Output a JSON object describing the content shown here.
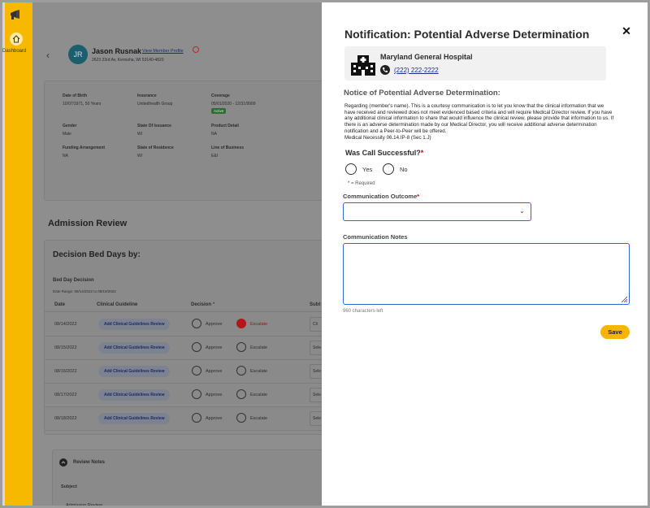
{
  "sidebar": {
    "nav_label": "Dashboard",
    "logo_icon": "bullhorn-icon",
    "home_icon": "home-icon",
    "accent_color": "#f7b800"
  },
  "member": {
    "initials": "JR",
    "name": "Jason Rusnak",
    "view_profile": "View Member Profile",
    "address": "2623 23rd Av, Kenosha, WI 53140-4820"
  },
  "info": {
    "dob_label": "Date of Birth",
    "dob": "10/07/1971, 50 Years",
    "insurance_label": "Insurance",
    "insurance": "Unitedhealth Group",
    "coverage_label": "Coverage",
    "coverage": "05/01/2020 - 12/31/9999",
    "coverage_status": "Active",
    "gender_label": "Gender",
    "gender": "Male",
    "state_ins_label": "State Of Issuance",
    "state_ins": "WI",
    "product_label": "Product Detail",
    "product": "NA",
    "funding_label": "Funding Arrangement",
    "funding": "NA",
    "residence_label": "State of Residence",
    "residence": "WI",
    "lob_label": "Line of Business",
    "lob": "E&I"
  },
  "admission": {
    "title": "Admission Review",
    "decision_title": "Decision Bed Days by:",
    "bed_day_title": "Bed Day Decision",
    "date_range": "Date Range: 08/14/2022 to 08/19/2022",
    "columns": [
      "Date",
      "Clinical Guideline",
      "Decision",
      "Subt"
    ],
    "guideline_btn": "Add Clinical Guidelines Review",
    "approve": "Approve",
    "escalate": "Escalate",
    "rows": [
      {
        "date": "08/14/2022",
        "select": "Cli"
      },
      {
        "date": "08/15/2022",
        "select": "Sele"
      },
      {
        "date": "08/16/2022",
        "select": "Sele"
      },
      {
        "date": "08/17/2022",
        "select": "Sele"
      },
      {
        "date": "08/18/2022",
        "select": "Sele"
      }
    ],
    "notes_title": "Review Notes",
    "notes_subject_label": "Subject",
    "notes_subject": "Admission Review"
  },
  "modal": {
    "title": "Notification: Potential Adverse Determination",
    "hospital_name": "Maryland General Hospital",
    "hospital_phone": "(222) 222-2222",
    "notice_title": "Notice of Potential Adverse Determination:",
    "notice_body": "Regarding (member's name).  This is a courtesy communication is to let you know that the clinical information that we have received and reviewed does not meet evidenced based criteria and will require Medical Director review. If you have any additional clinical information to share that would influence the clinical review, please provide that information to us.  If there is an adverse determination made by our Medical Director, you will receive additional adverse determination notification and a Peer-to-Peer will be offered.",
    "notice_ref": "Medical Necessity 06.14.IP-8 (Sec 1.J)",
    "question": "Was Call Successful?",
    "required_mark": "*",
    "yes": "Yes",
    "no": "No",
    "required_note": "= Required",
    "outcome_label": "Communication Outcome",
    "outcome_value": "",
    "notes_label": "Communication Notes",
    "notes_value": "",
    "chars_left": "960 characters left",
    "save": "Save"
  }
}
